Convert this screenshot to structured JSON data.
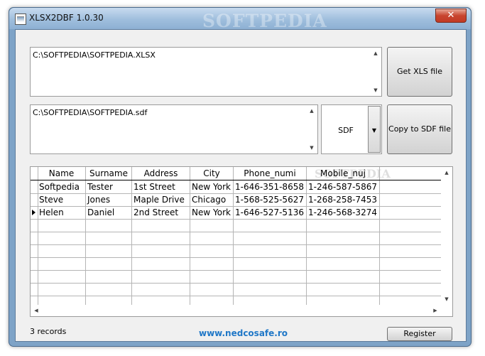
{
  "window": {
    "title": "XLSX2DBF 1.0.30",
    "watermark": "SOFTPEDIA",
    "close_symbol": "✕"
  },
  "xls_path": "C:\\SOFTPEDIA\\SOFTPEDIA.XLSX",
  "out_path": "C:\\SOFTPEDIA\\SOFTPEDIA.sdf",
  "buttons": {
    "get_xls": "Get XLS file",
    "copy_to": "Copy to SDF file",
    "register": "Register"
  },
  "format_combo": {
    "selected": "SDF"
  },
  "grid": {
    "watermark": "SOFTPEDIA",
    "columns": [
      "Name",
      "Surname",
      "Address",
      "City",
      "Phone_numi",
      "Mobile_nuj"
    ],
    "rows": [
      [
        "Softpedia",
        "Tester",
        "1st Street",
        "New York",
        "1-646-351-8658",
        "1-246-587-5867"
      ],
      [
        "Steve",
        "Jones",
        "Maple Drive",
        "Chicago",
        "1-568-525-5627",
        "1-268-258-7453"
      ],
      [
        "Helen",
        "Daniel",
        "2nd Street",
        "New York",
        "1-646-527-5136",
        "1-246-568-3274"
      ]
    ],
    "current_row": 2
  },
  "status": {
    "records": "3 records"
  },
  "footer": {
    "link": "www.nedcosafe.ro"
  },
  "icons": {
    "up": "▲",
    "down": "▼",
    "left": "◀",
    "right": "▶"
  }
}
